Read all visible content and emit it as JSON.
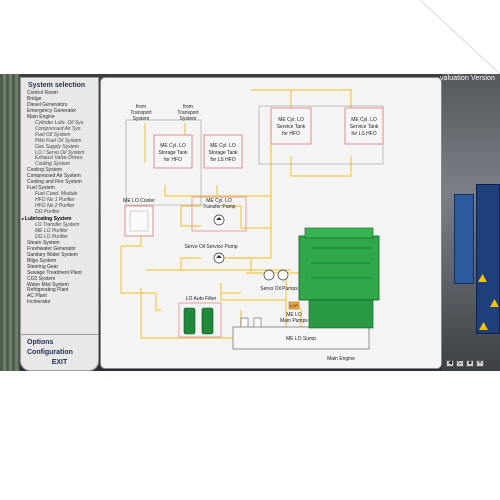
{
  "header": {
    "title": "valuation Version"
  },
  "menu": {
    "heading": "System selection",
    "items": [
      {
        "label": "Control Room",
        "level": 0
      },
      {
        "label": "Bridge",
        "level": 0
      },
      {
        "label": "Diesel Generators",
        "level": 0
      },
      {
        "label": "Emergency Generator",
        "level": 0
      },
      {
        "label": "Main Engine",
        "level": 0
      },
      {
        "label": "Cylinder Lubr. Oil Sys.",
        "level": 1
      },
      {
        "label": "Compressed Air Sys.",
        "level": 1
      },
      {
        "label": "Fuel Oil System",
        "level": 1
      },
      {
        "label": "Pilot Fuel Oil System",
        "level": 1
      },
      {
        "label": "Gas Supply System",
        "level": 1
      },
      {
        "label": "LO / Servo Oil System",
        "level": 1
      },
      {
        "label": "Exhaust Valve Drives",
        "level": 1
      },
      {
        "label": "Cooling System",
        "level": 1
      },
      {
        "label": "Cooling System",
        "level": 0
      },
      {
        "label": "Compressed Air System",
        "level": 0
      },
      {
        "label": "Cooling and Fire System",
        "level": 0
      },
      {
        "label": "Fuel System",
        "level": 0
      },
      {
        "label": "Fuel Cond. Module",
        "level": 1
      },
      {
        "label": "HFO No 1 Purifier",
        "level": 1
      },
      {
        "label": "HFO No 2 Purifier",
        "level": 1
      },
      {
        "label": "DO Purifier",
        "level": 1
      },
      {
        "label": "Lubricating System",
        "level": 0,
        "active": true
      },
      {
        "label": "LO Transfer System",
        "level": 1
      },
      {
        "label": "ME LO Purifier",
        "level": 1
      },
      {
        "label": "DG LO Purifier",
        "level": 1
      },
      {
        "label": "Steam System",
        "level": 0
      },
      {
        "label": "Freshwater Generator",
        "level": 0
      },
      {
        "label": "Sanitary Water System",
        "level": 0
      },
      {
        "label": "Bilge System",
        "level": 0
      },
      {
        "label": "Steering Gear",
        "level": 0
      },
      {
        "label": "Sewage Treatment Plant",
        "level": 0
      },
      {
        "label": "CO2 System",
        "level": 0
      },
      {
        "label": "Water Mist System",
        "level": 0
      },
      {
        "label": "Refrigerating Plant",
        "level": 0
      },
      {
        "label": "AC Plant",
        "level": 0
      },
      {
        "label": "Incinerator",
        "level": 0
      }
    ],
    "bottom": {
      "options": "Options",
      "configuration": "Configuration",
      "exit": "EXIT"
    }
  },
  "diagram": {
    "from_transport_1": [
      "from",
      "Transport",
      "System"
    ],
    "from_transport_2": [
      "from",
      "Transport",
      "System"
    ],
    "storage_hfo": [
      "ME Cyl. LO",
      "Storage Tank",
      "for HFO"
    ],
    "storage_ls_hfo": [
      "ME Cyl. LO",
      "Storage Tank",
      "for LS HFO"
    ],
    "service_hfo": [
      "ME Cyl. LO",
      "Service Tank",
      "for HFO"
    ],
    "service_ls_hfo": [
      "ME Cyl. LO",
      "Service Tank",
      "for LS HFO"
    ],
    "lo_cooler": "ME LO Cooler",
    "transfer_pump": [
      "ME Cyl. LO",
      "Transfer Pump"
    ],
    "servo_pump": "Servo Oil Service Pump",
    "servo_pumps": "Servo Oil Pumps",
    "auto_filter": "LO Auto Filter",
    "lop_badge": "LOP",
    "main_pumps": [
      "ME LO",
      "Main Pumps"
    ],
    "lo_sump": "ME LO Sump",
    "main_engine": "Main Engine"
  },
  "nav": {
    "back": "◀",
    "c": "C",
    "sq": "■",
    "x": "✕"
  },
  "colors": {
    "pipe": "#f2c84b",
    "engine": "#2fa84a",
    "tank_border": "#e08c8c",
    "menu_head": "#1e2e5a"
  }
}
